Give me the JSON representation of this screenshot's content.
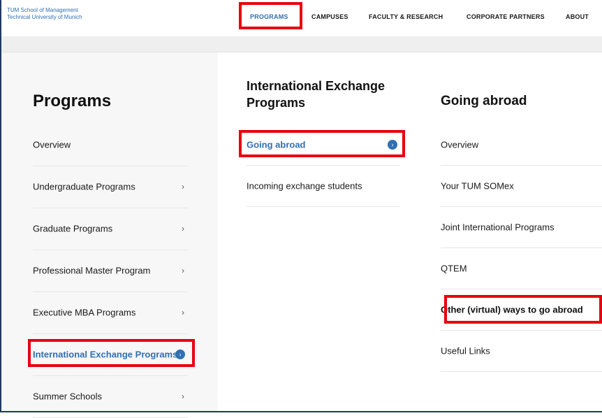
{
  "header": {
    "logo_line1": "TUM School of Management",
    "logo_line2": "Technical University of Munich",
    "nav": [
      "PROGRAMS",
      "CAMPUSES",
      "FACULTY & RESEARCH",
      "CORPORATE PARTNERS",
      "ABOUT"
    ],
    "active_nav": "PROGRAMS"
  },
  "left": {
    "title": "Programs",
    "items": [
      {
        "label": "Overview",
        "chevron": ""
      },
      {
        "label": "Undergraduate Programs",
        "chevron": "›"
      },
      {
        "label": "Graduate Programs",
        "chevron": "›"
      },
      {
        "label": "Professional Master Program",
        "chevron": "›"
      },
      {
        "label": "Executive MBA Programs",
        "chevron": "›"
      },
      {
        "label": "International Exchange Programs",
        "chevron": "›"
      },
      {
        "label": "Summer Schools",
        "chevron": "›"
      }
    ],
    "active_item": "International Exchange Programs"
  },
  "middle": {
    "title_line1": "International Exchange",
    "title_line2": "Programs",
    "items": [
      {
        "label": "Going abroad"
      },
      {
        "label": "Incoming exchange students"
      }
    ],
    "active_item": "Going abroad"
  },
  "right": {
    "title": "Going abroad",
    "items": [
      {
        "label": "Overview"
      },
      {
        "label": "Your TUM SOMex"
      },
      {
        "label": "Joint International Programs"
      },
      {
        "label": "QTEM"
      },
      {
        "label": "Other (virtual) ways to go abroad"
      },
      {
        "label": "Useful Links"
      }
    ]
  },
  "colors": {
    "accent": "#3070b3",
    "highlight": "#e8000f",
    "frame": "#1f3a5f"
  }
}
